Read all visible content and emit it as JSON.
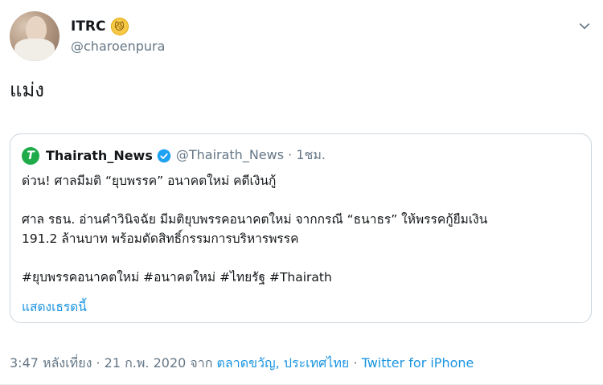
{
  "author": {
    "display_name": "ITRC",
    "emoji": "😼",
    "handle": "@charoenpura"
  },
  "tweet": {
    "text": "แม่ง"
  },
  "quoted": {
    "logo_letter": "T",
    "display_name": "Thairath_News",
    "handle_time": "@Thairath_News · 1ชม.",
    "lines": [
      "ด่วน! ศาลมีมติ “ยุบพรรค” อนาคตใหม่ คดีเงินกู้",
      "ศาล รธน. อ่านคำวินิจฉัย มีมติยุบพรรคอนาคตใหม่ จากกรณี “ธนาธร” ให้พรรคกู้ยืมเงิน",
      "191.2 ล้านบาท พร้อมตัดสิทธิ์กรรมการบริหารพรรค",
      "#ยุบพรรคอนาคตใหม่ #อนาคตใหม่ #ไทยรัฐ #Thairath"
    ],
    "show_thread": "แสดงเธรดนี้"
  },
  "meta": {
    "time_date": "3:47 หลังเที่ยง · 21 ก.พ. 2020 จาก ",
    "location": "ตลาดขวัญ, ประเทศไทย",
    "separator": " · ",
    "source": "Twitter for iPhone"
  },
  "colors": {
    "link": "#1b95e0",
    "muted": "#657786",
    "brand_green": "#1fab4a"
  },
  "icons": [
    "chevron-down-icon",
    "verified-badge-icon"
  ]
}
